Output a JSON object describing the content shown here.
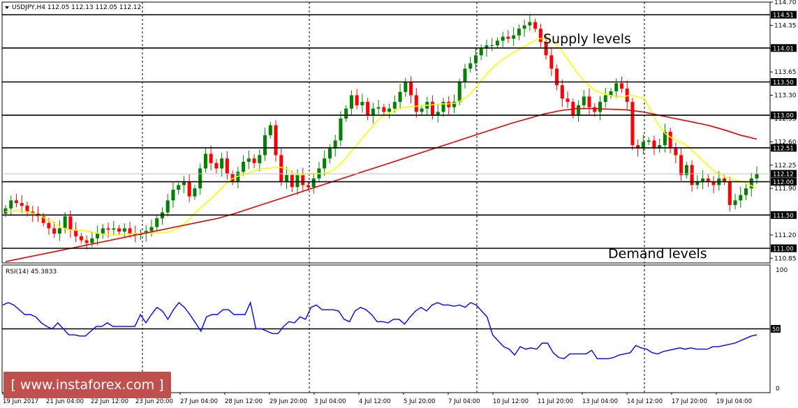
{
  "chart_data": {
    "type": "candlestick",
    "header": "USDJPY,H4  112.05 112.13 112.05 112.12",
    "annotations": [
      "Supply levels",
      "Demand levels"
    ],
    "price_axis": {
      "ylim": [
        110.78,
        114.7
      ],
      "ticks": [
        "114.70",
        "114.35",
        "114.00",
        "113.65",
        "113.30",
        "112.95",
        "112.60",
        "112.25",
        "111.90",
        "111.20",
        "110.85"
      ]
    },
    "levels": [
      {
        "value": 114.51,
        "label": "114.51"
      },
      {
        "value": 114.01,
        "label": "114.01"
      },
      {
        "value": 113.5,
        "label": "113.50"
      },
      {
        "value": 113.0,
        "label": "113.00"
      },
      {
        "value": 112.51,
        "label": "112.51"
      },
      {
        "value": 112.0,
        "label": "112.00"
      },
      {
        "value": 111.5,
        "label": "111.50"
      },
      {
        "value": 111.0,
        "label": "111.00"
      }
    ],
    "current_price": {
      "value": 112.12,
      "label": "112.12"
    },
    "x_labels": [
      "19 Jun 2017",
      "21 Jun 04:00",
      "22 Jun 12:00",
      "23 Jun 20:00",
      "27 Jun 04:00",
      "28 Jun 12:00",
      "29 Jun 20:00",
      "3 Jul 04:00",
      "4 Jul 12:00",
      "5 Jul 20:00",
      "7 Jul 04:00",
      "10 Jul 12:00",
      "11 Jul 20:00",
      "13 Jul 04:00",
      "14 Jul 12:00",
      "17 Jul 20:00",
      "19 Jul 04:00"
    ],
    "closes": [
      111.6,
      111.72,
      111.68,
      111.64,
      111.55,
      111.52,
      111.48,
      111.38,
      111.3,
      111.22,
      111.3,
      111.48,
      111.28,
      111.18,
      111.12,
      111.08,
      111.15,
      111.22,
      111.3,
      111.28,
      111.3,
      111.25,
      111.3,
      111.22,
      111.2,
      111.22,
      111.26,
      111.32,
      111.45,
      111.54,
      111.72,
      111.88,
      111.95,
      112.0,
      111.78,
      111.9,
      112.2,
      112.42,
      112.28,
      112.2,
      112.35,
      112.12,
      112.0,
      112.15,
      112.3,
      112.35,
      112.28,
      112.4,
      112.7,
      112.85,
      112.4,
      112.0,
      112.1,
      111.92,
      112.1,
      111.95,
      111.92,
      112.05,
      112.2,
      112.35,
      112.5,
      112.62,
      112.95,
      113.1,
      113.3,
      113.15,
      113.2,
      113.0,
      113.1,
      113.12,
      113.05,
      113.1,
      113.2,
      113.35,
      113.5,
      113.3,
      113.05,
      113.1,
      113.2,
      113.0,
      113.05,
      113.2,
      113.12,
      113.2,
      113.5,
      113.7,
      113.78,
      113.9,
      114.0,
      114.05,
      114.05,
      114.12,
      114.18,
      114.15,
      114.2,
      114.3,
      114.35,
      114.4,
      114.3,
      114.1,
      113.9,
      113.7,
      113.45,
      113.25,
      113.2,
      113.0,
      113.15,
      113.28,
      113.12,
      113.05,
      113.2,
      113.3,
      113.36,
      113.48,
      113.4,
      113.2,
      112.55,
      112.5,
      112.6,
      112.62,
      112.5,
      112.55,
      112.75,
      112.5,
      112.4,
      112.1,
      112.25,
      111.95,
      112.0,
      112.05,
      112.0,
      111.95,
      112.05,
      112.0,
      111.65,
      111.72,
      111.8,
      111.9,
      112.05,
      112.12
    ],
    "ema_fast": [
      111.55,
      111.56,
      111.57,
      111.55,
      111.52,
      111.48,
      111.43,
      111.37,
      111.31,
      111.28,
      111.27,
      111.27,
      111.25,
      111.23,
      111.21,
      111.2,
      111.2,
      111.21,
      111.22,
      111.22,
      111.23,
      111.23,
      111.23,
      111.24,
      111.27,
      111.33,
      111.42,
      111.53,
      111.63,
      111.72,
      111.82,
      111.93,
      112.03,
      112.08,
      112.11,
      112.15,
      112.18,
      112.2,
      112.21,
      112.22,
      112.2,
      112.12,
      112.1,
      112.12,
      112.13,
      112.12,
      112.14,
      112.2,
      112.3,
      112.42,
      112.55,
      112.68,
      112.8,
      112.92,
      113.0,
      113.05,
      113.1,
      113.12,
      113.13,
      113.14,
      113.15,
      113.16,
      113.17,
      113.17,
      113.18,
      113.23,
      113.3,
      113.42,
      113.55,
      113.67,
      113.77,
      113.85,
      113.92,
      113.98,
      114.04,
      114.1,
      114.15,
      114.15,
      114.1,
      114.0,
      113.85,
      113.7,
      113.56,
      113.45,
      113.37,
      113.33,
      113.3,
      113.28,
      113.28,
      113.3,
      113.28,
      113.25,
      113.05,
      112.85,
      112.72,
      112.65,
      112.6,
      112.55,
      112.45,
      112.35,
      112.25,
      112.15,
      112.1,
      112.05,
      112.02,
      112.0,
      111.95,
      111.9
    ],
    "ema_slow": [
      110.8,
      110.85,
      110.9,
      110.95,
      111.0,
      111.05,
      111.1,
      111.15,
      111.2,
      111.25,
      111.3,
      111.35,
      111.4,
      111.45,
      111.52,
      111.6,
      111.68,
      111.76,
      111.84,
      111.92,
      112.0,
      112.08,
      112.16,
      112.24,
      112.32,
      112.4,
      112.48,
      112.56,
      112.64,
      112.72,
      112.8,
      112.88,
      112.95,
      113.02,
      113.07,
      113.1,
      113.1,
      113.09,
      113.08,
      113.05,
      113.0,
      112.95,
      112.9,
      112.85,
      112.78,
      112.7,
      112.64
    ],
    "rsi": {
      "label": "RSI(14) 45.3833",
      "ticks": [
        "100",
        "0"
      ],
      "level": {
        "value": 50,
        "label": "50"
      },
      "values": [
        70,
        72,
        70,
        66,
        62,
        62,
        60,
        55,
        52,
        50,
        55,
        50,
        45,
        45,
        44,
        44,
        48,
        52,
        52,
        55,
        52,
        52,
        52,
        52,
        52,
        62,
        55,
        62,
        68,
        65,
        58,
        66,
        72,
        68,
        62,
        55,
        48,
        60,
        62,
        62,
        66,
        66,
        62,
        62,
        62,
        72,
        50,
        50,
        48,
        46,
        46,
        52,
        56,
        55,
        60,
        58,
        68,
        70,
        66,
        66,
        66,
        65,
        58,
        56,
        65,
        68,
        66,
        62,
        56,
        56,
        55,
        58,
        58,
        54,
        60,
        65,
        68,
        65,
        70,
        72,
        70,
        70,
        69,
        70,
        68,
        72,
        70,
        65,
        60,
        45,
        40,
        35,
        33,
        28,
        35,
        33,
        34,
        33,
        38,
        38,
        30,
        26,
        25,
        29,
        29,
        29,
        29,
        32,
        25,
        25,
        25,
        26,
        28,
        29,
        30,
        36,
        34,
        33,
        30,
        29,
        31,
        32,
        33,
        34,
        33,
        34,
        33,
        33,
        33,
        35,
        35,
        36,
        37,
        38,
        40,
        42,
        44,
        45
      ]
    }
  },
  "watermark": "[ www.instaforex.com ]"
}
